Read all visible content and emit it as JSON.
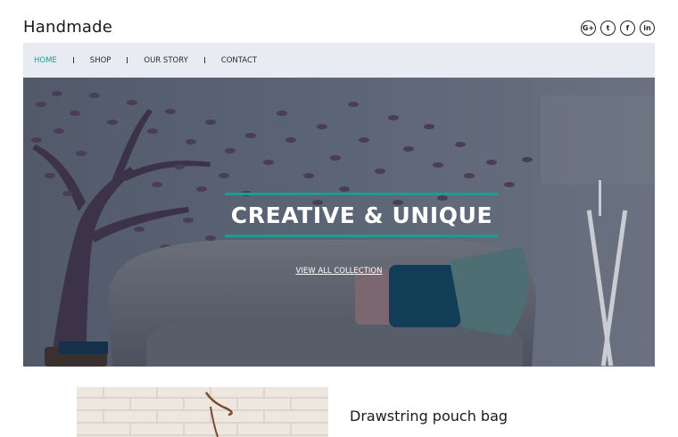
{
  "brand": {
    "name": "Handmade"
  },
  "socials": [
    {
      "icon": "google-plus-icon",
      "glyph": "G+"
    },
    {
      "icon": "twitter-icon",
      "glyph": "t"
    },
    {
      "icon": "facebook-icon",
      "glyph": "f"
    },
    {
      "icon": "linkedin-icon",
      "glyph": "in"
    }
  ],
  "nav": {
    "active_color": "#1d9c94",
    "items": [
      {
        "label": "HOME",
        "active": true
      },
      {
        "label": "SHOP",
        "active": false
      },
      {
        "label": "OUR STORY",
        "active": false
      },
      {
        "label": "CONTACT",
        "active": false
      }
    ]
  },
  "hero": {
    "title": "CREATIVE & UNIQUE",
    "link": "VIEW ALL COLLECTION",
    "accent": "#1d9c94"
  },
  "product": {
    "title": "Drawstring pouch bag"
  }
}
